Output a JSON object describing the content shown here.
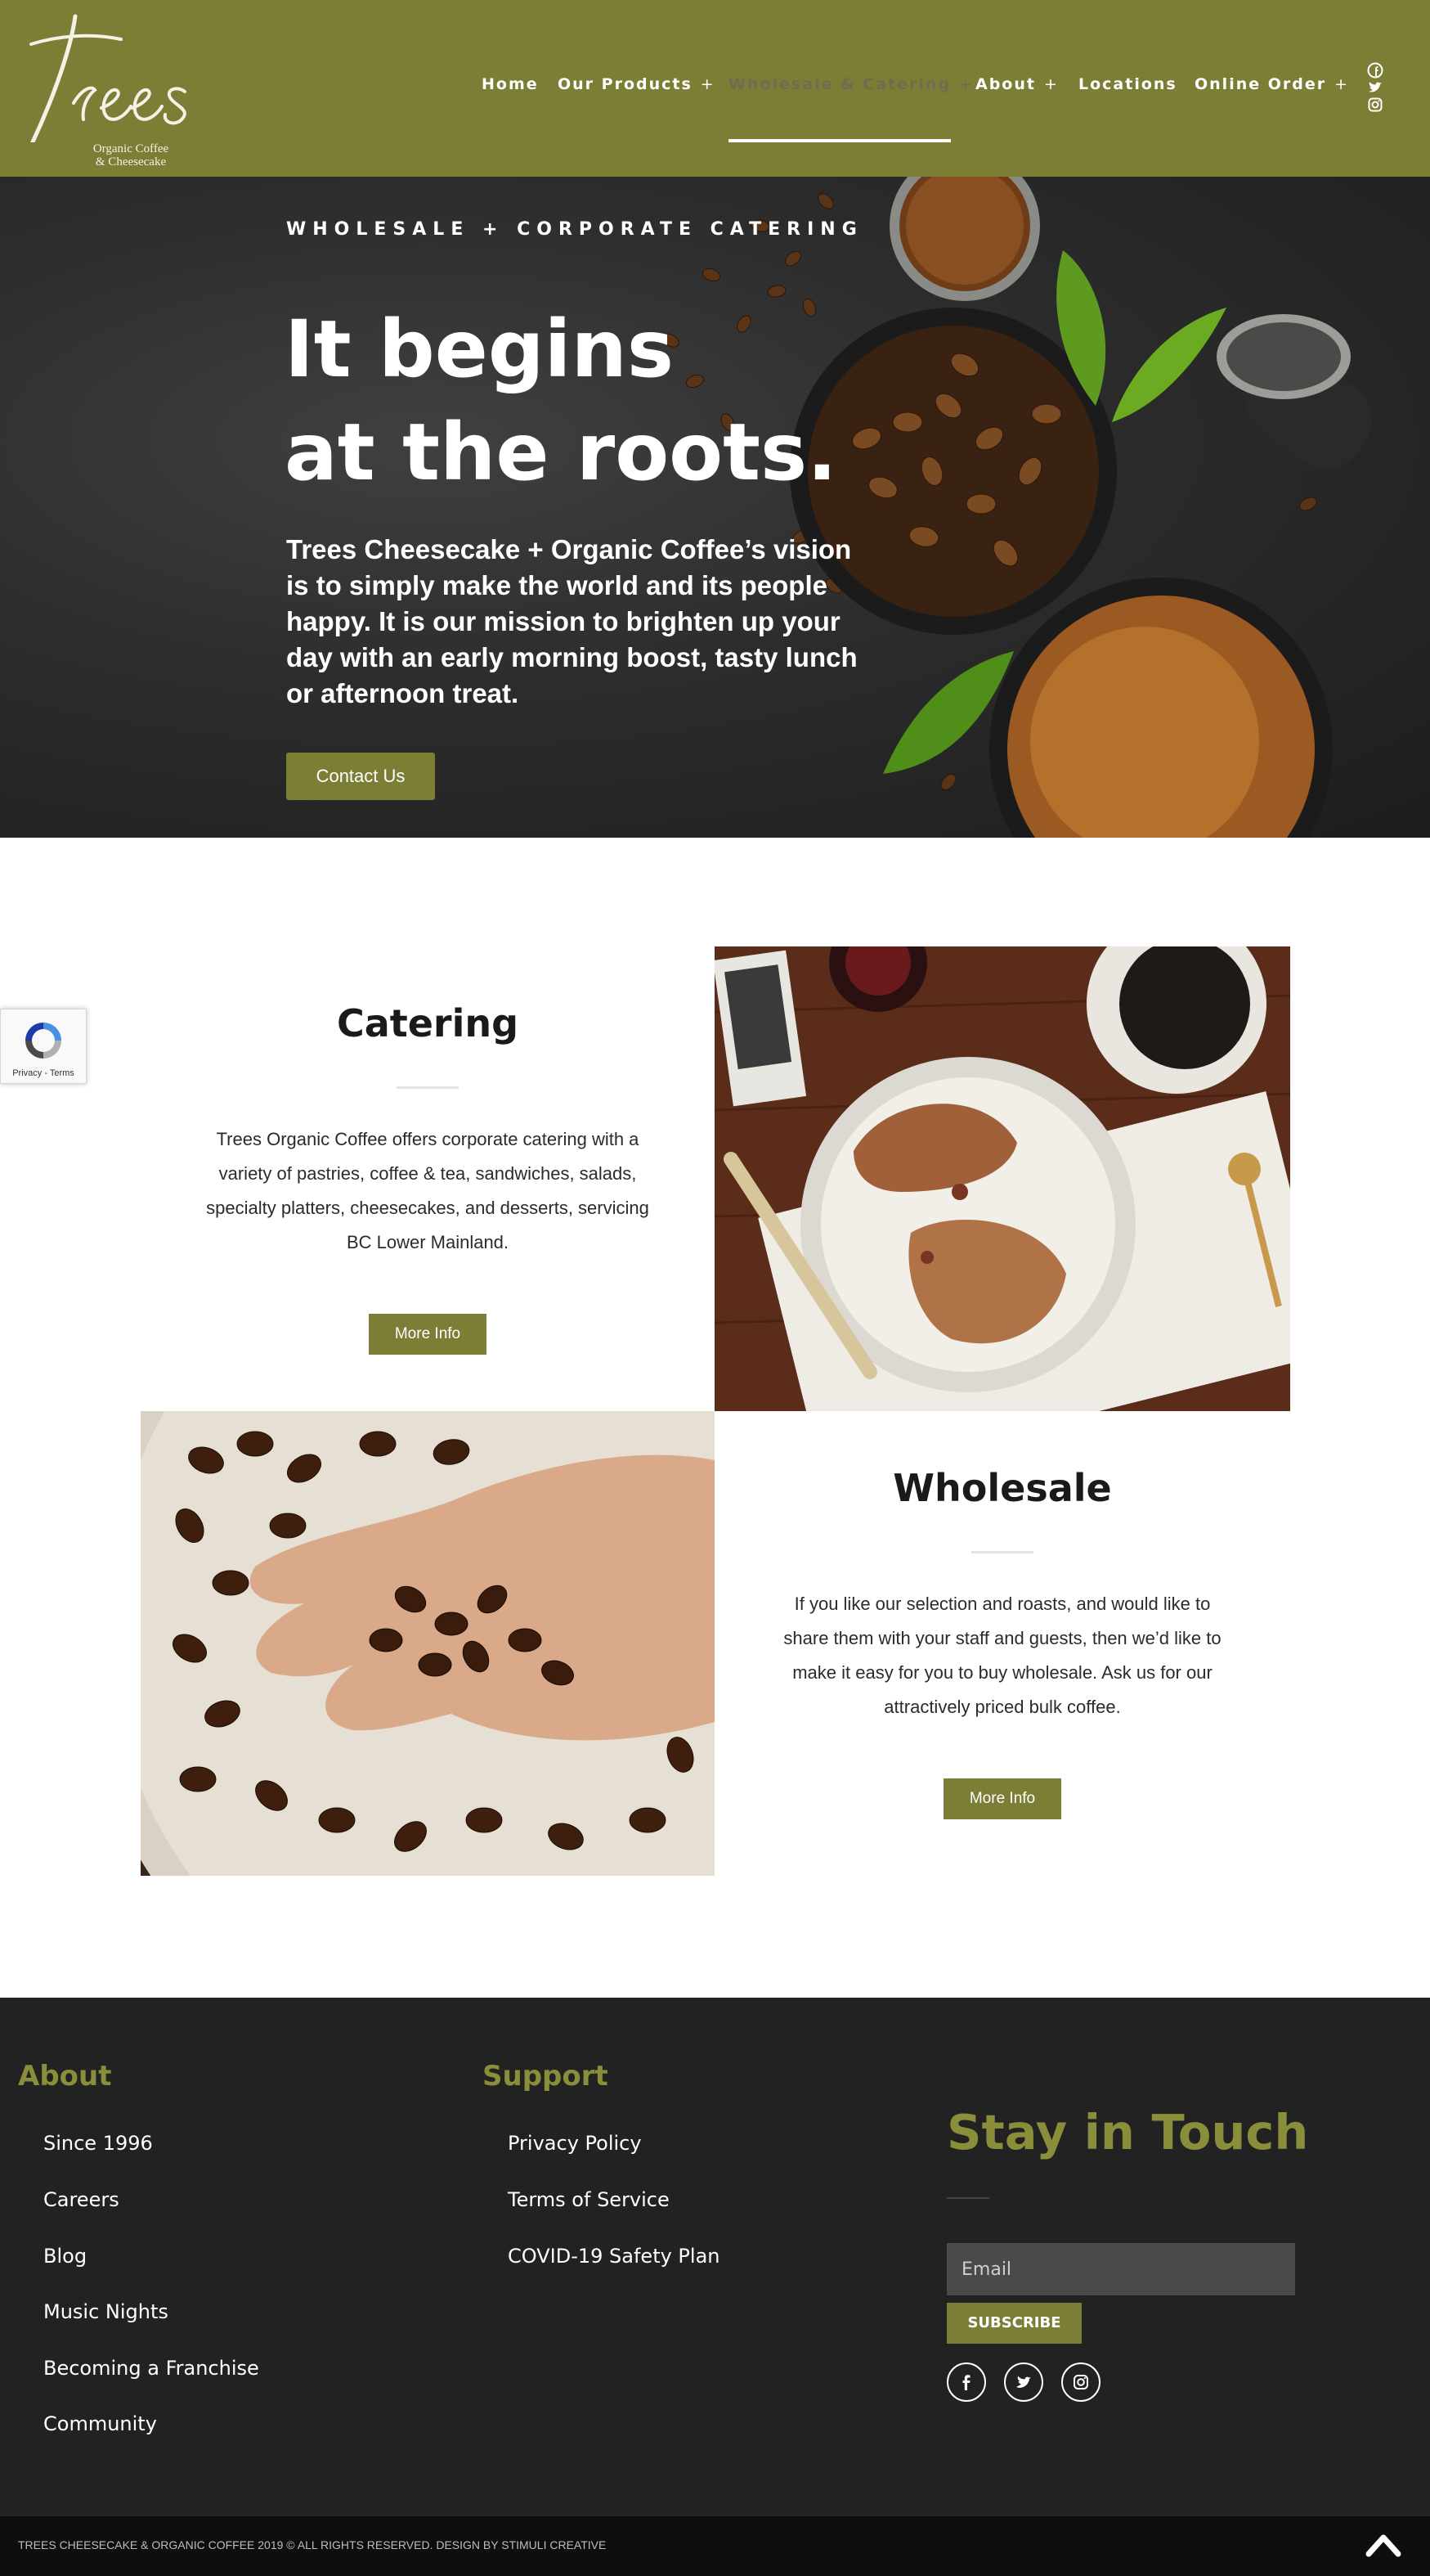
{
  "brand": {
    "logo_word": "Trees",
    "logo_sub_line1": "Organic Coffee",
    "logo_sub_line2": "& Cheesecake",
    "accent_color": "#7b7e34",
    "dark_color": "#222222"
  },
  "nav": {
    "items": [
      {
        "label": "Home",
        "has_submenu": false
      },
      {
        "label": "Our Products",
        "has_submenu": true
      },
      {
        "label": "Wholesale & Catering",
        "has_submenu": true,
        "active": true
      },
      {
        "label": "About",
        "has_submenu": true
      },
      {
        "label": "Locations",
        "has_submenu": false
      },
      {
        "label": "Online Order",
        "has_submenu": true
      }
    ],
    "submenu_marker": "+",
    "social_icons": [
      "facebook-icon",
      "twitter-icon",
      "instagram-icon"
    ]
  },
  "hero": {
    "kicker": "WHOLESALE + CORPORATE CATERING",
    "title_line1": "It begins",
    "title_line2": "at the roots.",
    "body": "Trees Cheesecake + Organic Coffee’s vision is to simply make the world and its people happy. It is our mission to brighten up your day with an early morning boost, tasty lunch or afternoon treat.",
    "cta_label": "Contact Us"
  },
  "recaptcha": {
    "links": "Privacy - Terms"
  },
  "catering": {
    "title": "Catering",
    "text": "Trees Organic Coffee offers corporate catering with a variety of pastries, coffee & tea, sandwiches, salads, specialty platters, cheesecakes, and desserts, servicing BC Lower Mainland.",
    "button": "More Info"
  },
  "wholesale": {
    "title": "Wholesale",
    "text": "If you like our selection and roasts, and would like to share them with your staff and guests, then we’d like to make it easy for you to buy wholesale. Ask us for our attractively priced bulk coffee.",
    "button": "More Info"
  },
  "footer": {
    "about": {
      "heading": "About",
      "links": [
        "Since 1996",
        "Careers",
        "Blog",
        "Music Nights",
        "Becoming a Franchise",
        "Community"
      ]
    },
    "support": {
      "heading": "Support",
      "links": [
        "Privacy Policy",
        "Terms of Service",
        "COVID-19 Safety Plan"
      ]
    },
    "newsletter": {
      "heading": "Stay in Touch",
      "email_placeholder": "Email",
      "email_value": "",
      "subscribe_label": "SUBSCRIBE"
    },
    "social_icons": [
      "facebook-icon",
      "twitter-icon",
      "instagram-icon"
    ],
    "copyright": "TREES CHEESECAKE & ORGANIC COFFEE 2019 © ALL RIGHTS RESERVED. DESIGN BY STIMULI CREATIVE"
  }
}
